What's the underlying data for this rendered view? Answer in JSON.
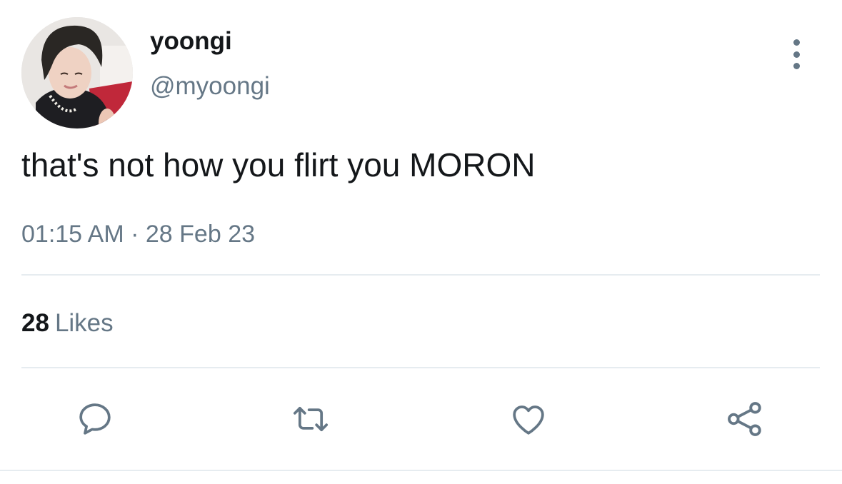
{
  "tweet": {
    "author": {
      "display_name": "yoongi",
      "handle": "@myoongi",
      "avatar": "profile-photo"
    },
    "text": "that's not how you flirt you MORON",
    "time": "01:15 AM",
    "separator": "·",
    "date": "28 Feb 23",
    "likes": {
      "count": "28",
      "label": "Likes"
    }
  },
  "actions": [
    {
      "name": "reply",
      "icon": "speech-bubble-icon"
    },
    {
      "name": "retweet",
      "icon": "retweet-icon"
    },
    {
      "name": "like",
      "icon": "heart-icon"
    },
    {
      "name": "share",
      "icon": "share-icon"
    }
  ],
  "colors": {
    "text_primary": "#14171a",
    "text_secondary": "#657786",
    "divider": "#e6ecf0",
    "background": "#ffffff"
  }
}
